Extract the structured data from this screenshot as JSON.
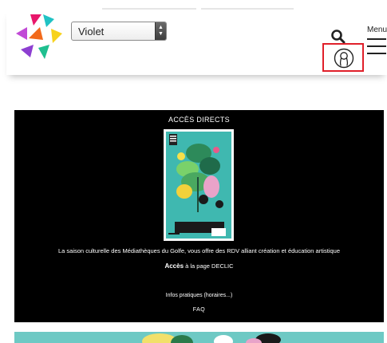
{
  "header": {
    "theme_select": {
      "value": "Violet"
    },
    "menu_label": "Menu"
  },
  "acces_directs": {
    "title": "ACCÈS DIRECTS",
    "poster_title": "DECLIC",
    "description": "La saison culturelle des Médiathèques du Golfe, vous offre des RDV alliant création et éducation artistique",
    "access_link": "Accès",
    "access_rest": " à la page DECLIC",
    "infos_link": "Infos pratiques (horaires...)",
    "faq_link": "FAQ"
  },
  "colors": {
    "panel_bg": "#000000",
    "highlight_border": "#e0202a",
    "banner_bg": "#6ec9c4",
    "poster_bg": "#3fb8b0"
  }
}
